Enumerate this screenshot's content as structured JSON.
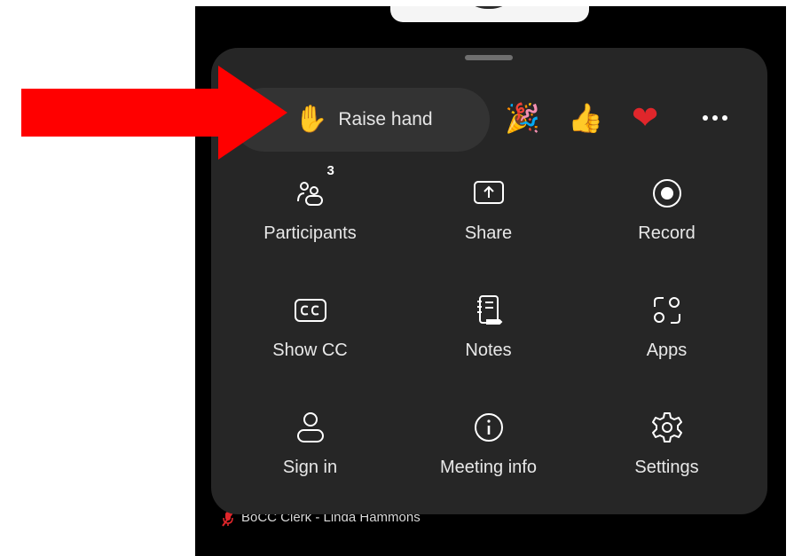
{
  "reactions": {
    "raise_hand_emoji": "✋",
    "raise_hand_label": "Raise hand",
    "party_emoji": "🎉",
    "thumbs_emoji": "👍",
    "heart_emoji": "❤",
    "more_icon": "ellipsis-icon"
  },
  "menu": {
    "items": [
      {
        "label": "Participants",
        "icon": "participants-icon",
        "badge": "3"
      },
      {
        "label": "Share",
        "icon": "share-icon"
      },
      {
        "label": "Record",
        "icon": "record-icon"
      },
      {
        "label": "Show CC",
        "icon": "closed-caption-icon"
      },
      {
        "label": "Notes",
        "icon": "notes-icon"
      },
      {
        "label": "Apps",
        "icon": "apps-icon"
      },
      {
        "label": "Sign in",
        "icon": "person-icon"
      },
      {
        "label": "Meeting info",
        "icon": "info-icon"
      },
      {
        "label": "Settings",
        "icon": "gear-icon"
      }
    ]
  },
  "participant_tag": {
    "name": "BoCC Clerk - Linda Hammons",
    "icon": "muted-mic-icon"
  },
  "colors": {
    "sheet_bg": "#262626",
    "arrow": "#ff0000",
    "heart": "#e0262b"
  }
}
